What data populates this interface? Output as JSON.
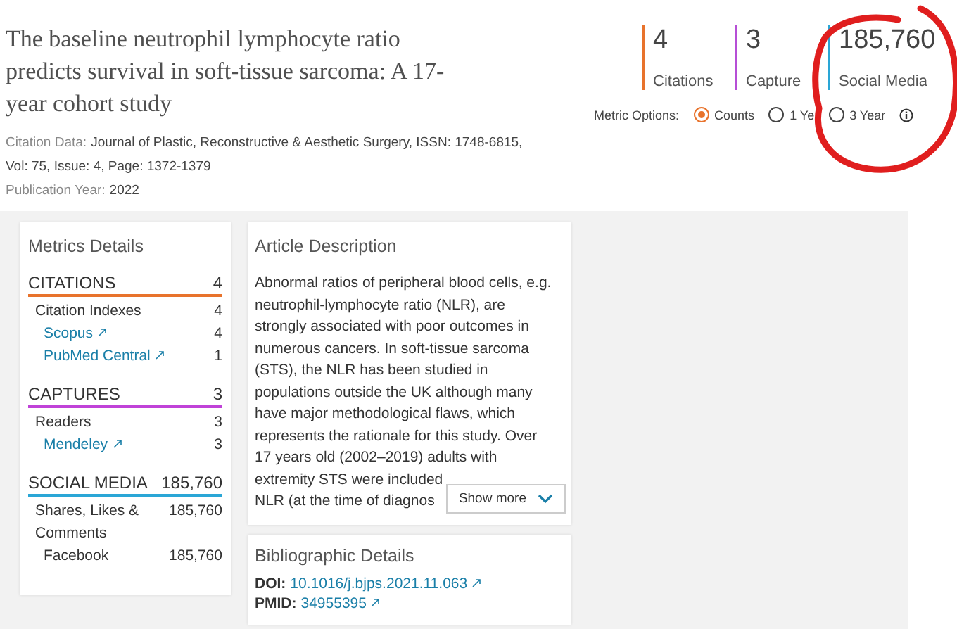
{
  "article": {
    "title": "The baseline neutrophil lymphocyte ratio predicts survival in soft-tissue sarcoma: A 17-year cohort study",
    "citation_data": [
      {
        "label": "Citation Data:",
        "value": "Journal of Plastic, Reconstructive & Aesthetic Surgery, ISSN: 1748-6815,"
      },
      {
        "value": "Vol: 75, Issue: 4, Page: 1372-1379"
      },
      {
        "label": "Publication Year:",
        "value": "2022"
      }
    ]
  },
  "summary_metrics": [
    {
      "value": "4",
      "label": "Citations",
      "color": "#e8732c"
    },
    {
      "value": "3",
      "label": "Capture",
      "color": "#b64fd6"
    },
    {
      "value": "185,760",
      "label": "Social Media",
      "color": "#2aa6d6"
    }
  ],
  "metric_options": {
    "label": "Metric Options:",
    "options": [
      {
        "label": "Counts",
        "selected": true
      },
      {
        "label": "1 Ye",
        "selected": false
      },
      {
        "label": "3 Year",
        "selected": false
      }
    ]
  },
  "metrics_details": {
    "title": "Metrics Details",
    "sections": [
      {
        "title": "CITATIONS",
        "count": "4",
        "color": "#e8732c",
        "rows": [
          {
            "kind": "group",
            "label": "Citation Indexes",
            "value": "4"
          },
          {
            "kind": "link",
            "label": "Scopus",
            "value": "4"
          },
          {
            "kind": "link",
            "label": "PubMed Central",
            "value": "1"
          }
        ]
      },
      {
        "title": "CAPTURES",
        "count": "3",
        "color": "#c042d8",
        "rows": [
          {
            "kind": "group",
            "label": "Readers",
            "value": "3"
          },
          {
            "kind": "link",
            "label": "Mendeley",
            "value": "3"
          }
        ]
      },
      {
        "title": "SOCIAL MEDIA",
        "count": "185,760",
        "color": "#2aa6d6",
        "rows": [
          {
            "kind": "group",
            "label": "Shares, Likes & Comments",
            "value": "185,760"
          },
          {
            "kind": "item",
            "label": "Facebook",
            "value": "185,760"
          }
        ]
      }
    ]
  },
  "article_description": {
    "title": "Article Description",
    "lines": [
      "Abnormal ratios of peripheral blood cells, e.g.",
      "neutrophil-lymphocyte ratio (NLR), are",
      "strongly associated with poor outcomes in",
      "numerous cancers. In soft-tissue sarcoma",
      "(STS), the NLR has been studied in",
      "populations outside the UK although many",
      "have major methodological flaws, which",
      "represents the rationale for this study. Over",
      "17 years old (2002–2019) adults with",
      "extremity STS were included",
      "NLR (at the time of diagnos"
    ],
    "show_more": "Show more"
  },
  "bibliographic_details": {
    "title": "Bibliographic Details",
    "items": [
      {
        "label": "DOI:",
        "value": "10.1016/j.bjps.2021.11.063"
      },
      {
        "label": "PMID:",
        "value": "34955395"
      }
    ]
  }
}
